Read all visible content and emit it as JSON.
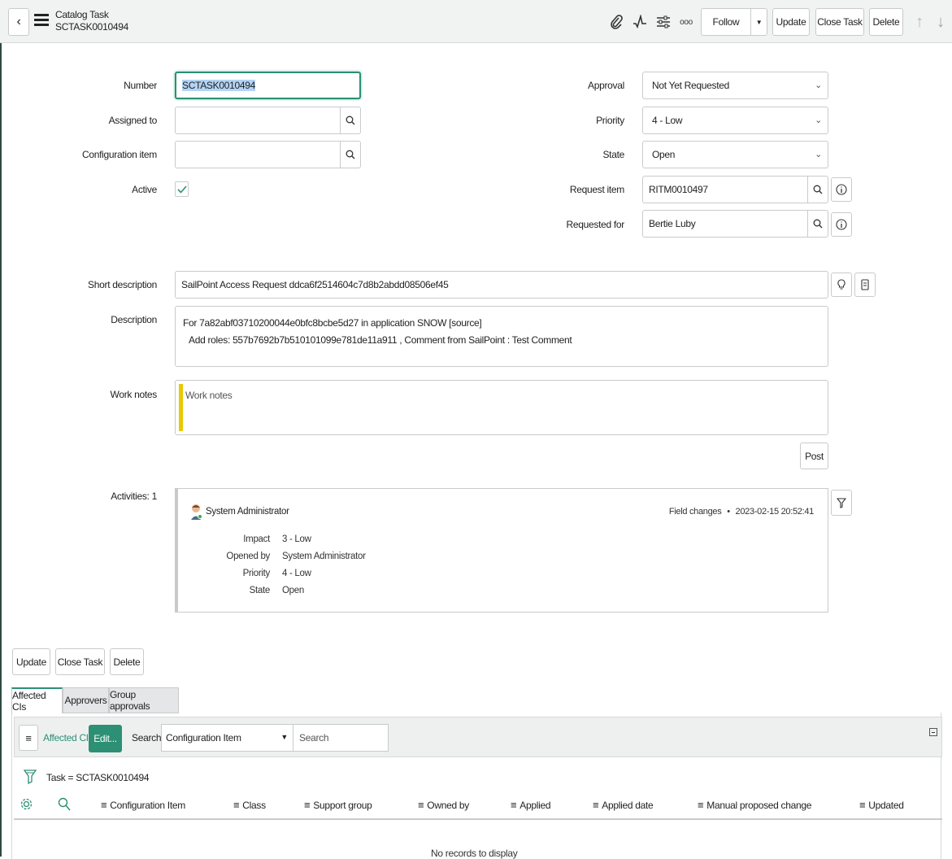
{
  "header": {
    "title": "Catalog Task",
    "number": "SCTASK0010494",
    "follow_label": "Follow",
    "update_label": "Update",
    "close_task_label": "Close Task",
    "delete_label": "Delete",
    "more_icon_text": "ooo"
  },
  "form": {
    "number_label": "Number",
    "number_value": "SCTASK0010494",
    "assigned_to_label": "Assigned to",
    "assigned_to_value": "",
    "config_item_label": "Configuration item",
    "config_item_value": "",
    "active_label": "Active",
    "active_checked": true,
    "approval_label": "Approval",
    "approval_value": "Not Yet Requested",
    "priority_label": "Priority",
    "priority_value": "4 - Low",
    "state_label": "State",
    "state_value": "Open",
    "request_item_label": "Request item",
    "request_item_value": "RITM0010497",
    "requested_for_label": "Requested for",
    "requested_for_value": "Bertie Luby",
    "short_desc_label": "Short description",
    "short_desc_value": "SailPoint Access Request ddca6f2514604c7d8b2abdd08506ef45",
    "description_label": "Description",
    "description_line1": "For 7a82abf03710200044e0bfc8bcbe5d27 in application SNOW [source]",
    "description_line2": "Add roles: 557b7692b7b510101099e781de11a911 , Comment from SailPoint : Test Comment",
    "work_notes_label": "Work notes",
    "work_notes_placeholder": "Work notes",
    "post_label": "Post",
    "activities_label": "Activities: 1"
  },
  "activity": {
    "user": "System Administrator",
    "type": "Field changes",
    "separator": "•",
    "timestamp": "2023-02-15 20:52:41",
    "changes": [
      {
        "label": "Impact",
        "value": "3 - Low"
      },
      {
        "label": "Opened by",
        "value": "System Administrator"
      },
      {
        "label": "Priority",
        "value": "4 - Low"
      },
      {
        "label": "State",
        "value": "Open"
      }
    ]
  },
  "bottom_buttons": {
    "update_label": "Update",
    "close_task_label": "Close Task",
    "delete_label": "Delete"
  },
  "related": {
    "tabs": [
      "Affected CIs",
      "Approvers",
      "Group approvals"
    ],
    "list_title": "Affected CIs",
    "edit_label": "Edit...",
    "search_label": "Search",
    "search_field_value": "Configuration Item",
    "search_placeholder": "Search",
    "filter_text": "Task = SCTASK0010494",
    "columns": [
      "Configuration Item",
      "Class",
      "Support group",
      "Owned by",
      "Applied",
      "Applied date",
      "Manual proposed change",
      "Updated"
    ],
    "empty_text": "No records to display"
  },
  "colors": {
    "accent": "#2d8f74",
    "work_notes_bar": "#e8c800",
    "online": "#3cb043"
  }
}
